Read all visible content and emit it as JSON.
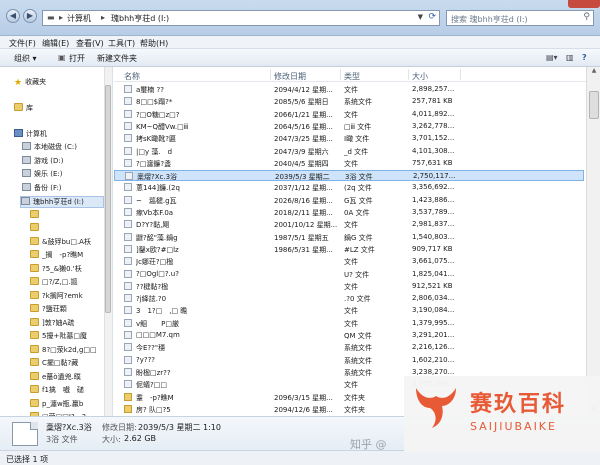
{
  "colors": {
    "accent": "#cfe3fa",
    "brand": "#e8542e"
  },
  "address": {
    "prefix": "▬",
    "seg1": "计算机",
    "seg2": "瑰bhh亨荘d (I:)"
  },
  "search": {
    "placeholder": "搜索 瑰bhh亨荘d (I:)"
  },
  "menu": [
    "文件(F)",
    "编辑(E)",
    "查看(V)",
    "工具(T)",
    "帮助(H)"
  ],
  "toolbar": {
    "organize": "组织 ▾",
    "open": "打开",
    "new_folder": "新建文件夹"
  },
  "nav": {
    "favorites": "收藏夹",
    "library": "库",
    "computer": "计算机",
    "drives": [
      "本地磁盘 (C:)",
      "游戏 (D:)",
      "娱乐 (E:)",
      "备份 (F:)",
      "瑰bhh亨荘d (I:)"
    ],
    "folders": [
      "",
      "",
      "&鼓殍bu□.A枖",
      "_搁　-p?瞧M",
      "?5_&獭0.'枖",
      "□?/Z,□.謳",
      "?k搁阿?emk",
      "?鹽荘顆",
      "]敦?妯A疏",
      "5擾+阰墓□魔",
      "8?□荥k2d,g□□",
      "C擺□黏?藏",
      "e蕞ò遺兇.瞨",
      "f1擒　嚱　磓",
      "p_瀍w瓶.臝b",
      "□荥□□I?　3"
    ]
  },
  "columns": {
    "name": "名称",
    "date": "修改日期",
    "type": "类型",
    "size": "大小"
  },
  "rows": [
    {
      "name": "a璽楠 ??",
      "date": "2094/4/12 星期...",
      "type": "文件",
      "size": "2,898,257..."
    },
    {
      "name": "8□□$蹋?*",
      "date": "2085/5/6 星期日",
      "type": "系统文件",
      "size": "257,781 KB"
    },
    {
      "name": "?□O糖□z□?",
      "date": "2066/1/21 星期...",
      "type": "文件",
      "size": "4,011,892..."
    },
    {
      "name": "KM~Q醴Vw.□ⅲ",
      "date": "2064/5/16 星期...",
      "type": "□ⅲ 文件",
      "size": "3,262,778..."
    },
    {
      "name": "拷sK瞰靴?匾",
      "date": "2047/3/25 星期...",
      "type": "I瞰 文件",
      "size": "3,701,152..."
    },
    {
      "name": "|□y 藻.　d",
      "date": "2047/3/9 星期六",
      "type": "_d 文件",
      "size": "4,101,308..."
    },
    {
      "name": "?□瀍鐮?盞",
      "date": "2040/4/5 星期四",
      "type": "文件",
      "size": "757,631 KB"
    },
    {
      "name": "稾熠?Xc.3浴",
      "date": "2039/5/3 星期二",
      "type": "3浴 文件",
      "size": "2,750,117..."
    },
    {
      "name": "蔥144]鐮.(2q",
      "date": "2037/1/12 星期...",
      "type": "(2q 文件",
      "size": "3,356,692..."
    },
    {
      "name": "~　瀶楗.g瓦",
      "date": "2026/8/16 星期...",
      "type": "G瓦 文件",
      "size": "1,423,886..."
    },
    {
      "name": "瘃Vb本F.0a",
      "date": "2018/2/11 星期...",
      "type": "0A 文件",
      "size": "3,537,789..."
    },
    {
      "name": "D?Y?黏,飓",
      "date": "2001/10/12 星期...",
      "type": "文件",
      "size": "2,981,837..."
    },
    {
      "name": "鼴?酩\"藻.鍋g",
      "date": "1987/5/1 星期五",
      "type": "鍋G 文件",
      "size": "1,540,803..."
    },
    {
      "name": "]鑿x欧?#□lz",
      "date": "1986/5/31 星期...",
      "type": "#LZ 文件",
      "size": "909,717 KB"
    },
    {
      "name": "Jc娜荘?□楹",
      "date": "",
      "type": "文件",
      "size": "3,661,075..."
    },
    {
      "name": "?□Ogl□?.u?",
      "date": "",
      "type": "U? 文件",
      "size": "1,825,041..."
    },
    {
      "name": "??楗黏?楹",
      "date": "",
      "type": "文件",
      "size": "912,521 KB"
    },
    {
      "name": "?j絳詃.?0",
      "date": "",
      "type": ".?0 文件",
      "size": "2,806,034..."
    },
    {
      "name": "3　1?□　,□ 瞻",
      "date": "",
      "type": "文件",
      "size": "3,190,084..."
    },
    {
      "name": "v鮂　　P□厳",
      "date": "",
      "type": "文件",
      "size": "1,379,995..."
    },
    {
      "name": "□□□M7.qm",
      "date": "",
      "type": "QM 文件",
      "size": "3,291,201..."
    },
    {
      "name": "今E??\"穩",
      "date": "",
      "type": "系统文件",
      "size": "2,216,126..."
    },
    {
      "name": "?y???",
      "date": "",
      "type": "系统文件",
      "size": "1,602,210..."
    },
    {
      "name": "盼楹□zr??",
      "date": "",
      "type": "系统文件",
      "size": "3,238,270..."
    },
    {
      "name": "伲蟻?□□",
      "date": "",
      "type": "文件",
      "size": "3,770,493..."
    },
    {
      "name": "耋　-p?瞧M",
      "date": "2096/3/15 星期...",
      "type": "文件夹",
      "size": ""
    },
    {
      "name": "房? 队□?5",
      "date": "2094/12/6 星期...",
      "type": "文件夹",
      "size": ""
    },
    {
      "name": "!巠.□窫□2..",
      "date": "2093/11/3 星期...",
      "type": "文件夹",
      "size": ""
    }
  ],
  "details": {
    "name": "稾熠?Xc.3浴",
    "modified_label": "修改日期:",
    "modified": "2039/5/3 星期二 1:10",
    "type": "3浴 文件",
    "size_label": "大小:",
    "size": "2.62 GB"
  },
  "status": "已选择 1 项",
  "watermark": {
    "cn": "赛玖百科",
    "en": "SAIJIUBAIKE",
    "zhihu": "知乎 @"
  }
}
